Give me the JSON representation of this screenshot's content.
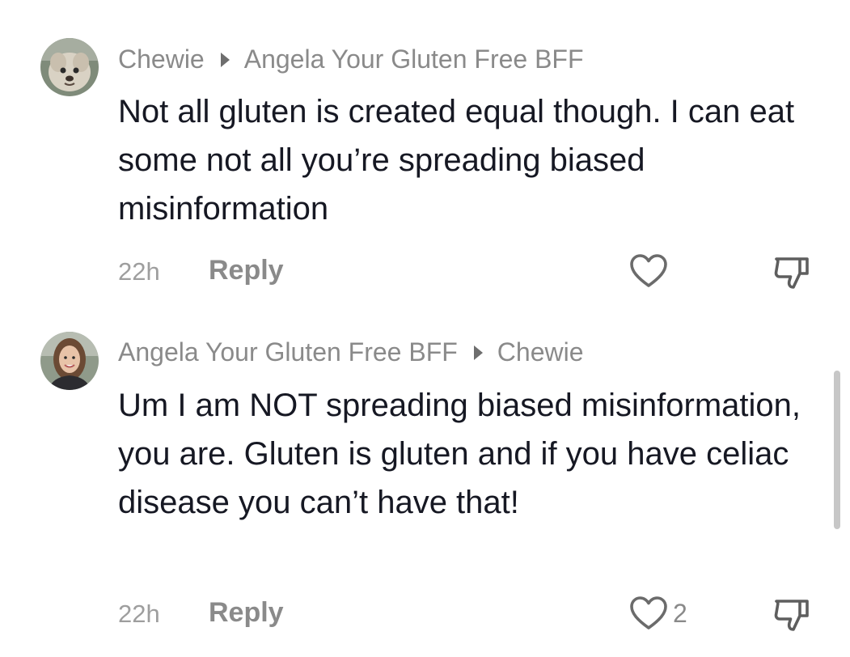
{
  "comments": [
    {
      "author": "Chewie",
      "reply_to": "Angela Your Gluten Free BFF",
      "text": "Not all gluten is created equal though. I can eat some not all you’re spreading biased misinformation",
      "time": "22h",
      "reply_label": "Reply",
      "like_count": "",
      "avatar_icon": "dog-avatar"
    },
    {
      "author": "Angela Your Gluten Free BFF",
      "reply_to": "Chewie",
      "text": "Um I am NOT spreading biased misinformation, you are. Gluten is gluten and if you have celiac disease you can’t have that!",
      "time": "22h",
      "reply_label": "Reply",
      "like_count": "2",
      "avatar_icon": "woman-avatar"
    }
  ],
  "icons": {
    "like": "heart-outline-icon",
    "dislike": "thumbs-down-icon",
    "caret": "caret-right-icon"
  },
  "colors": {
    "text": "#161823",
    "muted": "#8a8a8a",
    "scrollbar": "#c7c7c7"
  }
}
